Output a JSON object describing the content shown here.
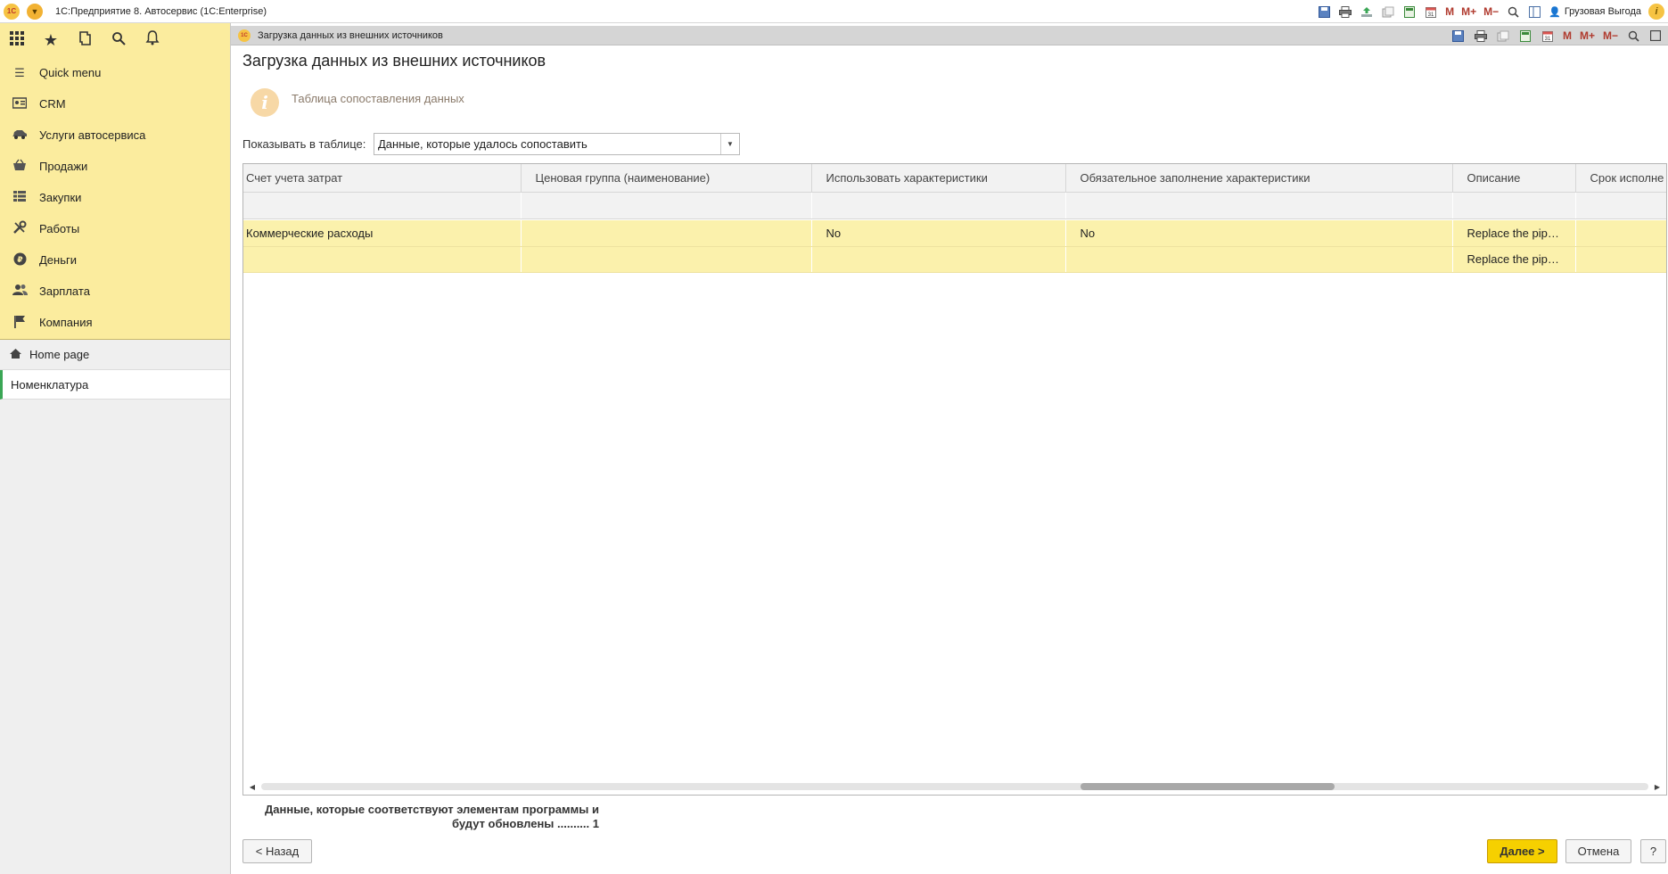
{
  "app": {
    "title": "1С:Предприятие 8. Автосервис  (1С:Enterprise)",
    "logo_text": "1С",
    "user": "Грузовая Выгода"
  },
  "toolbar_icons": [
    "save-icon",
    "print-icon",
    "upload-icon",
    "copy-icon",
    "calculator-icon",
    "calendar-icon",
    "m-icon",
    "m-plus-icon",
    "m-minus-icon",
    "zoom-icon",
    "panel-icon"
  ],
  "memory_labels": {
    "m": "M",
    "m_plus": "M+",
    "m_minus": "M−"
  },
  "sidebar": {
    "quick_icons": [
      "apps-grid-icon",
      "favorites-star-icon",
      "history-icon",
      "search-icon",
      "notifications-bell-icon"
    ],
    "items": [
      {
        "label": "Quick menu",
        "icon": "menu-icon"
      },
      {
        "label": "CRM",
        "icon": "crm-icon"
      },
      {
        "label": "Услуги автосервиса",
        "icon": "car-icon"
      },
      {
        "label": "Продажи",
        "icon": "basket-icon"
      },
      {
        "label": "Закупки",
        "icon": "purchases-icon"
      },
      {
        "label": "Работы",
        "icon": "tools-icon"
      },
      {
        "label": "Деньги",
        "icon": "money-icon"
      },
      {
        "label": "Зарплата",
        "icon": "people-icon"
      },
      {
        "label": "Компания",
        "icon": "flag-icon"
      }
    ],
    "home": "Home page",
    "open_windows": [
      "Номенклатура"
    ]
  },
  "document": {
    "tab_title": "Загрузка данных из внешних источников",
    "page_title": "Загрузка данных из внешних источников",
    "info_text": "Таблица сопоставления данных",
    "show_label": "Показывать в таблице:",
    "show_value": "Данные, которые удалось сопоставить"
  },
  "table": {
    "columns": [
      "Счет учета затрат",
      "Ценовая группа (наименование)",
      "Использовать характеристики",
      "Обязательное заполнение характеристики",
      "Описание",
      "Срок исполне"
    ],
    "rows": [
      [
        "Коммерческие расходы",
        "",
        "No",
        "No",
        "Replace the pip…",
        ""
      ],
      [
        "",
        "",
        "",
        "",
        "Replace the pip…",
        ""
      ]
    ]
  },
  "summary": {
    "line1": "Данные, которые соответствуют элементам программы и",
    "line2": "будут обновлены .......... 1"
  },
  "buttons": {
    "back": "< Назад",
    "next": "Далее >",
    "cancel": "Отмена",
    "help": "?"
  }
}
